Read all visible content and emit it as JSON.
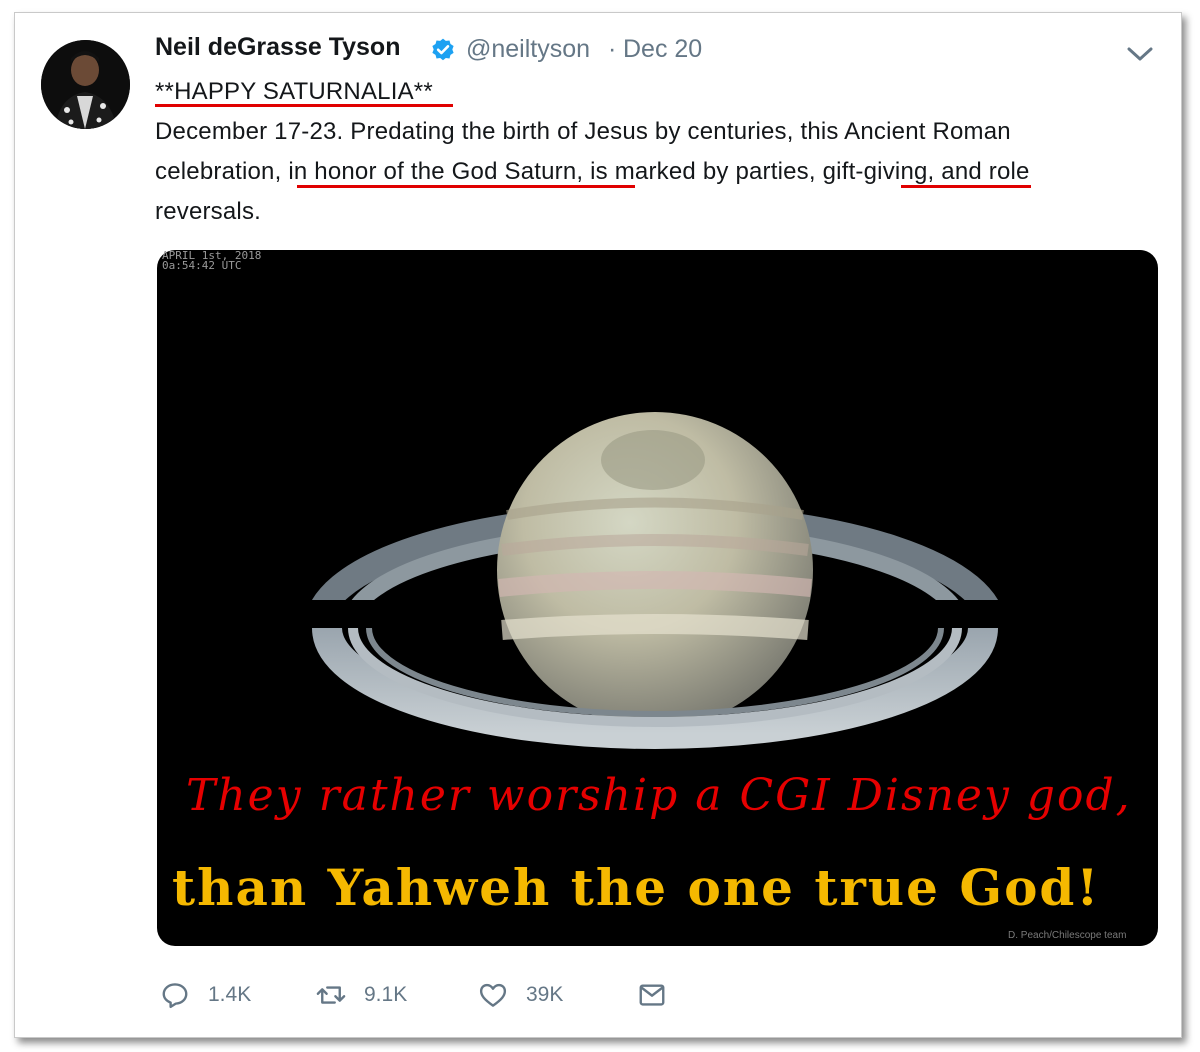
{
  "tweet": {
    "author_name": "Neil deGrasse Tyson",
    "handle": "@neiltyson",
    "separator": "·",
    "date": "Dec 20",
    "line1": "**HAPPY SATURNALIA**",
    "line2": "December 17-23.  Predating the birth of Jesus by centuries, this Ancient Roman",
    "line3": "celebration, in honor of the God Saturn, is marked by parties, gift-giving, and role",
    "line4": "reversals."
  },
  "media": {
    "timestamp_line1": "APRIL 1st, 2018",
    "timestamp_line2": "0a:54:42 UTC",
    "credit": "D. Peach/Chilescope team",
    "overlay_line1": "They rather worship a CGI Disney god,",
    "overlay_line2": "than Yahweh the one true God!"
  },
  "actions": {
    "replies": "1.4K",
    "retweets": "9.1K",
    "likes": "39K"
  },
  "colors": {
    "underline": "#e00000",
    "verified": "#1da1f2",
    "overlay_red": "#e60000",
    "overlay_gold": "#f5b800"
  },
  "icons": [
    "verified-badge-icon",
    "chevron-down-icon",
    "reply-icon",
    "retweet-icon",
    "like-icon",
    "direct-message-icon"
  ]
}
